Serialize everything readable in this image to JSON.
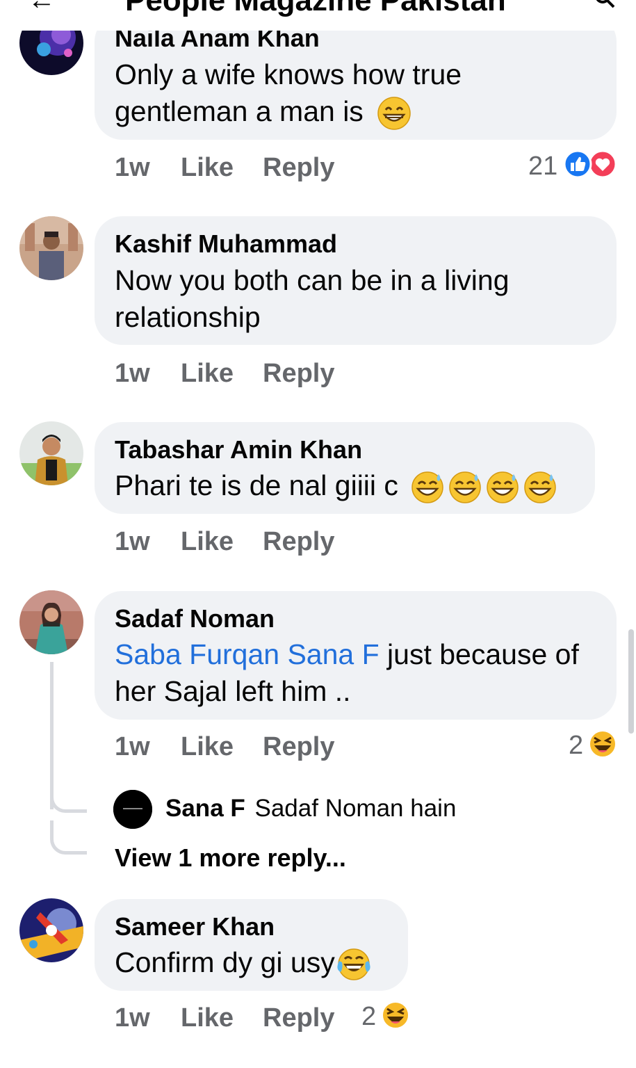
{
  "header": {
    "title": "People Magazine Pakistan"
  },
  "comments": [
    {
      "author": "Naila Anam Khan",
      "text_lines": [
        "Only a wife knows how true",
        "gentleman a man is"
      ],
      "time": "1w",
      "like": "Like",
      "reply": "Reply",
      "reactions": {
        "count": "21",
        "icons": [
          "like-icon",
          "love-icon"
        ]
      }
    },
    {
      "author": "Kashif Muhammad",
      "text_lines": [
        "Now you both can be in a living",
        "relationship"
      ],
      "time": "1w",
      "like": "Like",
      "reply": "Reply"
    },
    {
      "author": "Tabashar Amin Khan",
      "text": "Phari te is de nal giiii c",
      "time": "1w",
      "like": "Like",
      "reply": "Reply"
    },
    {
      "author": "Sadaf Noman",
      "mention": "Saba Furqan Sana F",
      "text_rest": "just because of",
      "text_line2": "her Sajal left him ..",
      "time": "1w",
      "like": "Like",
      "reply": "Reply",
      "reactions": {
        "count": "2",
        "icons": [
          "haha-icon"
        ]
      },
      "reply_preview": {
        "author": "Sana F",
        "text": "Sadaf Noman hain"
      },
      "view_more": "View 1 more reply..."
    },
    {
      "author": "Sameer Khan",
      "text": "Confirm dy gi usy",
      "time": "1w",
      "like": "Like",
      "reply": "Reply",
      "reactions": {
        "count": "2",
        "icons": [
          "haha-icon"
        ]
      }
    }
  ],
  "colors": {
    "bubble": "#f0f2f5",
    "mention": "#216fdb",
    "meta": "#65676b",
    "like_blue": "#1877f2",
    "love_red": "#f33e58",
    "haha_yellow": "#f7b928"
  }
}
